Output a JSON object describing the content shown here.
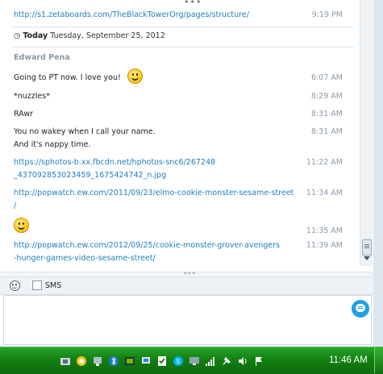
{
  "chat": {
    "top_message": {
      "text": "http://s1.zetaboards.com/TheBlackTowerOrg/pages/structure/",
      "time": "9:19 PM"
    },
    "date_header": {
      "day": "Today",
      "date": "Tuesday, September 25, 2012"
    },
    "sender": "Edward Pena",
    "messages": [
      {
        "text": "Going to PT now. I love you!",
        "time": "6:07 AM"
      },
      {
        "text": "*nuzzles*",
        "time": "8:29 AM"
      },
      {
        "text": "RAwr",
        "time": "8:31 AM"
      },
      {
        "line1": "You no wakey when I call your name.",
        "line2": "And it's nappy time.",
        "time": "8:31 AM"
      },
      {
        "line1": "https://sphotos-b.xx.fbcdn.net/hphotos-snc6/267248",
        "line2": "_437092853023459_1675424742_n.jpg",
        "time": "11:22 AM"
      },
      {
        "line1": "http://popwatch.ew.com/2011/09/23/elmo-cookie-monster-sesame-street",
        "line2": "/",
        "time": "11:34 AM"
      },
      {
        "time": "11:35 AM"
      },
      {
        "line1": "http://popwatch.ew.com/2012/09/25/cookie-monster-grover-avengers",
        "line2": "-hunger-games-video-sesame-street/",
        "time": "11:39 AM"
      }
    ]
  },
  "toolbar": {
    "sms_label": "SMS"
  },
  "taskbar": {
    "clock": "11:46 AM"
  },
  "colors": {
    "link": "#1d7ec5",
    "taskbar": "#128012",
    "send": "#1da1e2"
  }
}
